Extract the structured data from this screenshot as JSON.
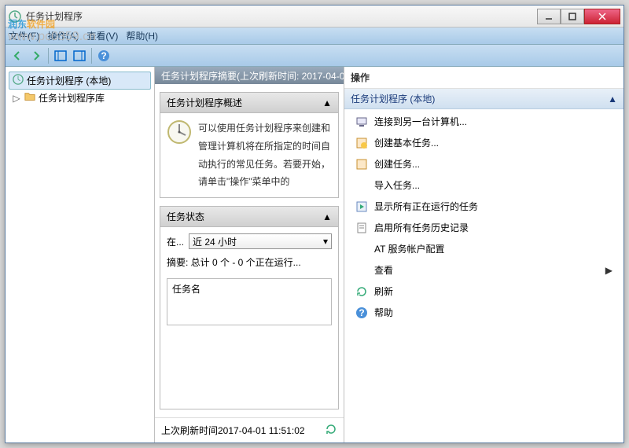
{
  "window": {
    "title": "任务计划程序"
  },
  "watermark": {
    "text1": "润东",
    "text2": "软件园",
    "url": "www.pc0359.cn"
  },
  "menubar": {
    "file": "文件(F)",
    "action": "操作(A)",
    "view": "查看(V)",
    "help": "帮助(H)"
  },
  "tree": {
    "root": "任务计划程序 (本地)",
    "library": "任务计划程序库"
  },
  "middle": {
    "header": "任务计划程序摘要(上次刷新时间: 2017-04-0",
    "overview": {
      "title": "任务计划程序概述",
      "text": "可以使用任务计划程序来创建和管理计算机将在所指定的时间自动执行的常见任务。若要开始，请单击\"操作\"菜单中的"
    },
    "status": {
      "title": "任务状态",
      "label": "在...",
      "dropdown": "近 24 小时",
      "summary": "摘要: 总计 0 个 - 0 个正在运行...",
      "taskname_header": "任务名"
    },
    "footer": "上次刷新时间2017-04-01 11:51:02"
  },
  "right": {
    "header": "操作",
    "section": "任务计划程序 (本地)",
    "actions": {
      "connect": "连接到另一台计算机...",
      "create_basic": "创建基本任务...",
      "create_task": "创建任务...",
      "import": "导入任务...",
      "show_running": "显示所有正在运行的任务",
      "enable_history": "启用所有任务历史记录",
      "at_config": "AT 服务帐户配置",
      "view": "查看",
      "refresh": "刷新",
      "help": "帮助"
    }
  }
}
